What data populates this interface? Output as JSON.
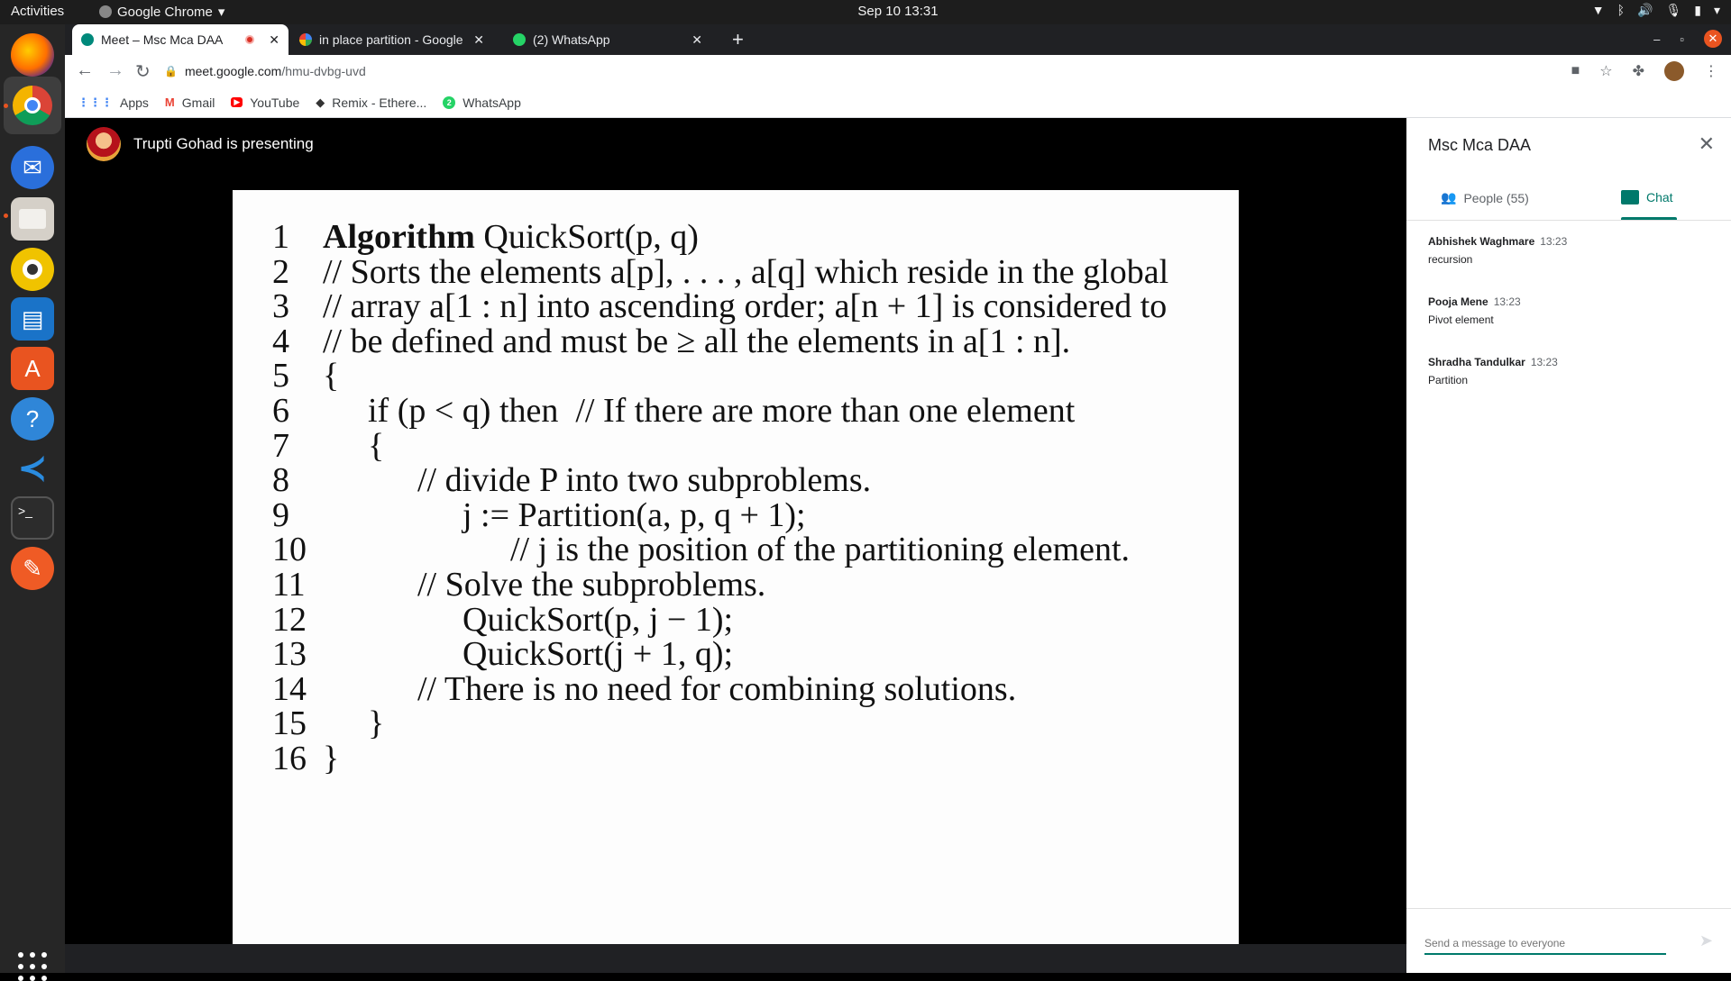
{
  "topbar": {
    "activities": "Activities",
    "app_name": "Google Chrome",
    "clock": "Sep 10  13:31"
  },
  "dock": {
    "items": [
      "firefox-icon",
      "chrome-icon",
      "thunderbird-icon",
      "files-icon",
      "rhythmbox-icon",
      "writer-icon",
      "software-icon",
      "help-icon",
      "vscode-icon",
      "terminal-icon",
      "postman-icon"
    ]
  },
  "tabs": [
    {
      "title": "Meet – Msc Mca DAA"
    },
    {
      "title": "in place partition - Google"
    },
    {
      "title": "(2) WhatsApp"
    }
  ],
  "url": {
    "host": "meet.google.com",
    "path": "/hmu-dvbg-uvd"
  },
  "bookmarks": [
    "Apps",
    "Gmail",
    "YouTube",
    "Remix - Ethere...",
    "WhatsApp"
  ],
  "meet": {
    "presenter_text": "Trupti Gohad is presenting"
  },
  "slide": {
    "lines": [
      {
        "n": "1",
        "indent": 0,
        "html_bold": "Algorithm",
        "text": " QuickSort(p, q)"
      },
      {
        "n": "2",
        "indent": 0,
        "text": "// Sorts the elements a[p], . . . , a[q] which reside in the global"
      },
      {
        "n": "3",
        "indent": 0,
        "text": "// array a[1 : n] into ascending order; a[n + 1] is considered to"
      },
      {
        "n": "4",
        "indent": 0,
        "text": "// be defined and must be ≥ all the elements in a[1 : n]."
      },
      {
        "n": "5",
        "indent": 0,
        "text": "{"
      },
      {
        "n": "6",
        "indent": 1,
        "text": "if (p < q) then  // If there are more than one element"
      },
      {
        "n": "7",
        "indent": 1,
        "text": "{"
      },
      {
        "n": "8",
        "indent": 2,
        "text": "// divide P into two subproblems."
      },
      {
        "n": "9",
        "indent": 3,
        "text": "j := Partition(a, p, q + 1);"
      },
      {
        "n": "10",
        "indent": 4,
        "text": "// j is the position of the partitioning element."
      },
      {
        "n": "11",
        "indent": 2,
        "text": "// Solve the subproblems."
      },
      {
        "n": "12",
        "indent": 3,
        "text": "QuickSort(p, j − 1);"
      },
      {
        "n": "13",
        "indent": 3,
        "text": "QuickSort(j + 1, q);"
      },
      {
        "n": "14",
        "indent": 2,
        "text": "// There is no need for combining solutions."
      },
      {
        "n": "15",
        "indent": 1,
        "text": "}"
      },
      {
        "n": "16",
        "indent": 0,
        "text": "}"
      }
    ]
  },
  "panel": {
    "title": "Msc Mca DAA",
    "people_label": "People (55)",
    "chat_label": "Chat",
    "messages": [
      {
        "sender": "Abhishek Waghmare",
        "time": "13:23",
        "body": "recursion"
      },
      {
        "sender": "Pooja Mene",
        "time": "13:23",
        "body": "Pivot element"
      },
      {
        "sender": "Shradha Tandulkar",
        "time": "13:23",
        "body": "Partition"
      }
    ],
    "compose_placeholder": "Send a message to everyone"
  },
  "colors": {
    "accent": "#00796b",
    "record": "#d93025",
    "ubuntu_orange": "#e95420"
  }
}
